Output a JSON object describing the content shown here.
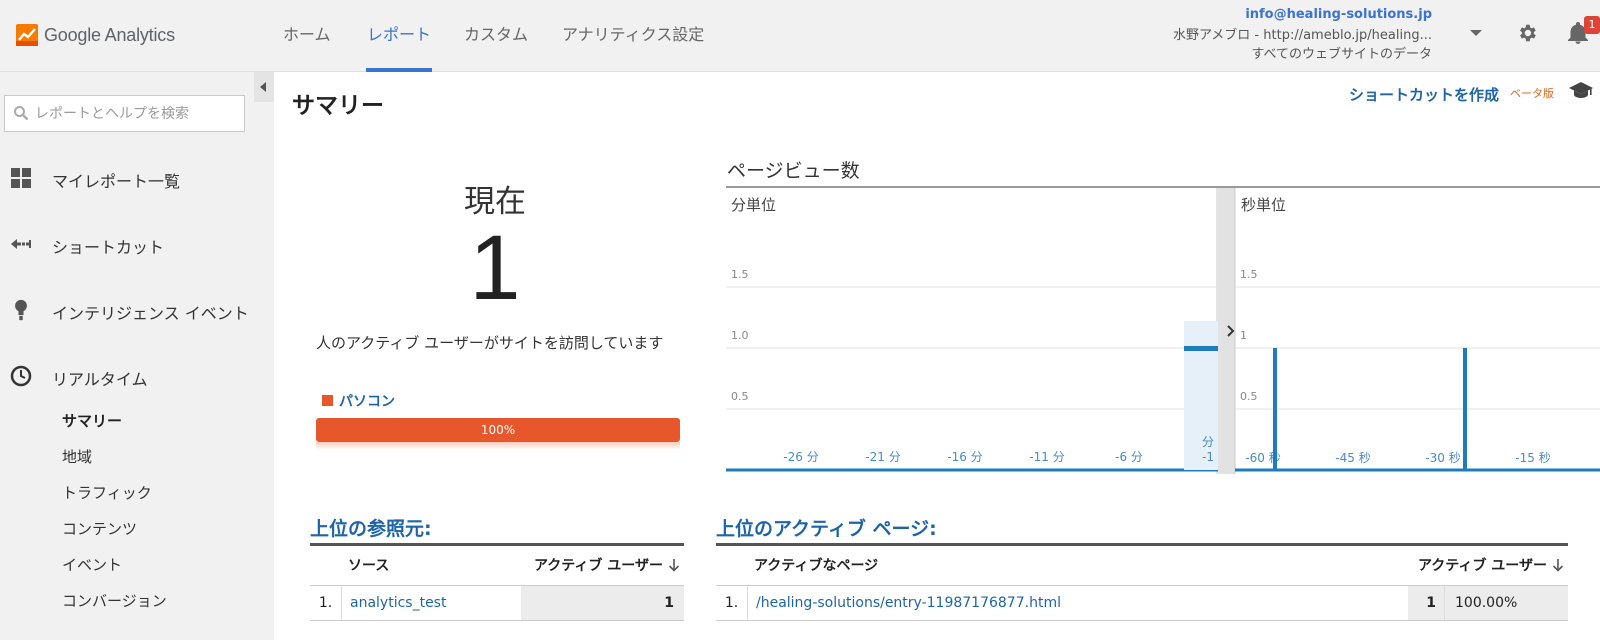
{
  "header": {
    "logo_text": "Google Analytics",
    "tabs": [
      {
        "label": "ホーム",
        "active": false
      },
      {
        "label": "レポート",
        "active": true
      },
      {
        "label": "カスタム",
        "active": false
      },
      {
        "label": "アナリティクス設定",
        "active": false
      }
    ],
    "account_email": "info@healing-solutions.jp",
    "account_property": "水野アメブロ - http://ameblo.jp/healing...",
    "account_view": "すべてのウェブサイトのデータ",
    "notification_count": "1",
    "icons": {
      "settings": "gear-icon",
      "notifications": "bell-icon",
      "account_menu": "chevron-down-icon"
    },
    "accent_color": "#3a73d1"
  },
  "sidebar": {
    "search_placeholder": "レポートとヘルプを検索",
    "items": [
      {
        "label": "マイレポート一覧",
        "icon": "grid-icon"
      },
      {
        "label": "ショートカット",
        "icon": "shortcut-arrow-icon"
      },
      {
        "label": "インテリジェンス イベント",
        "icon": "lightbulb-icon"
      },
      {
        "label": "リアルタイム",
        "icon": "clock-icon"
      }
    ],
    "realtime_subitems": [
      {
        "label": "サマリー",
        "active": true
      },
      {
        "label": "地域",
        "active": false
      },
      {
        "label": "トラフィック",
        "active": false
      },
      {
        "label": "コンテンツ",
        "active": false
      },
      {
        "label": "イベント",
        "active": false
      },
      {
        "label": "コンバージョン",
        "active": false
      }
    ]
  },
  "main": {
    "title": "サマリー",
    "shortcut_label": "ショートカットを作成",
    "beta_label": "ベータ版",
    "now_label": "現在",
    "active_users": "1",
    "visit_text": "人のアクティブ ユーザーがサイトを訪問しています",
    "device_label": "パソコン",
    "device_percent": "100%",
    "device_fraction": 1.0,
    "device_color": "#e8572c",
    "pageviews_title": "ページビュー数",
    "top_referrers": {
      "title": "上位の参照元:",
      "columns": [
        "ソース",
        "アクティブ ユーザー"
      ],
      "rows": [
        {
          "index": "1.",
          "source": "analytics_test",
          "users": "1"
        }
      ]
    },
    "top_pages": {
      "title": "上位のアクティブ ページ:",
      "columns": [
        "アクティブなページ",
        "アクティブ ユーザー"
      ],
      "rows": [
        {
          "index": "1.",
          "page": "/healing-solutions/entry-11987176877.html",
          "users": "1",
          "percent": "100.00%"
        }
      ]
    }
  },
  "chart_data": [
    {
      "type": "bar",
      "title": "分単位",
      "x_unit": "分",
      "x_ticks": [
        "-26 分",
        "-21 分",
        "-16 分",
        "-11 分",
        "-6 分"
      ],
      "last_tick_lines": [
        "分",
        "-1"
      ],
      "y_ticks": [
        "0.5",
        "1.0",
        "1.5"
      ],
      "ylim": [
        0,
        2
      ],
      "x_range": [
        -30,
        -1
      ],
      "values": [
        {
          "x": -1,
          "y": 1
        }
      ],
      "color": "#1f7bbf"
    },
    {
      "type": "bar",
      "title": "秒単位",
      "x_unit": "秒",
      "x_ticks": [
        "-60 秒",
        "-45 秒",
        "-30 秒",
        "-15 秒"
      ],
      "y_ticks": [
        "0.5",
        "1",
        "1.5"
      ],
      "ylim": [
        0,
        2
      ],
      "x_range": [
        -60,
        0
      ],
      "values": [
        {
          "x": -60,
          "y": 1
        },
        {
          "x": -30,
          "y": 1
        }
      ],
      "color": "#1f7bbf"
    }
  ]
}
